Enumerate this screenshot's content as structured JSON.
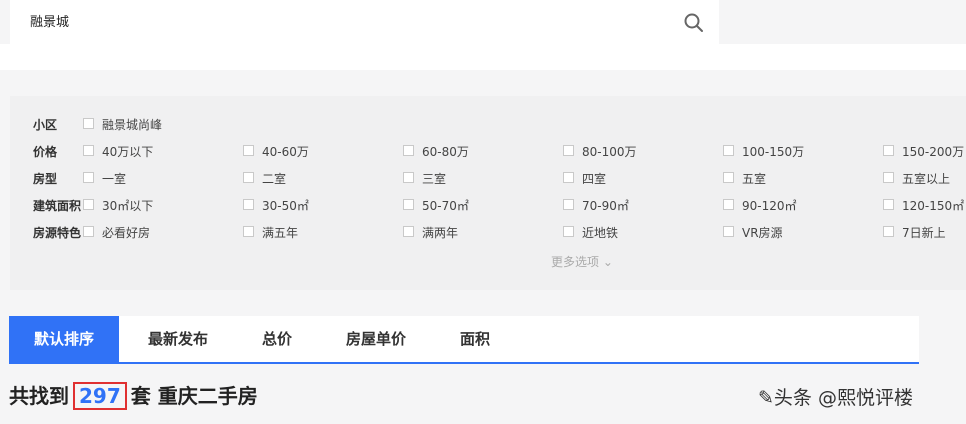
{
  "search": {
    "value": "融景城",
    "icon": "search-icon"
  },
  "filters": [
    {
      "label": "小区",
      "options": [
        "融景城尚峰"
      ]
    },
    {
      "label": "价格",
      "options": [
        "40万以下",
        "40-60万",
        "60-80万",
        "80-100万",
        "100-150万",
        "150-200万"
      ]
    },
    {
      "label": "房型",
      "options": [
        "一室",
        "二室",
        "三室",
        "四室",
        "五室",
        "五室以上"
      ]
    },
    {
      "label": "建筑面积",
      "options": [
        "30㎡以下",
        "30-50㎡",
        "50-70㎡",
        "70-90㎡",
        "90-120㎡",
        "120-150㎡"
      ]
    },
    {
      "label": "房源特色",
      "options": [
        "必看好房",
        "满五年",
        "满两年",
        "近地铁",
        "VR房源",
        "7日新上"
      ]
    }
  ],
  "more_filters": "更多选项 ⌄",
  "sort_tabs": [
    "默认排序",
    "最新发布",
    "总价",
    "房屋单价",
    "面积"
  ],
  "result": {
    "prefix": "共找到",
    "count": "297",
    "suffix": "套 重庆二手房"
  },
  "watermark": "✎头条 @熙悦评楼",
  "colors": {
    "accent": "#3072f6",
    "highlight_box": "#e03030"
  }
}
